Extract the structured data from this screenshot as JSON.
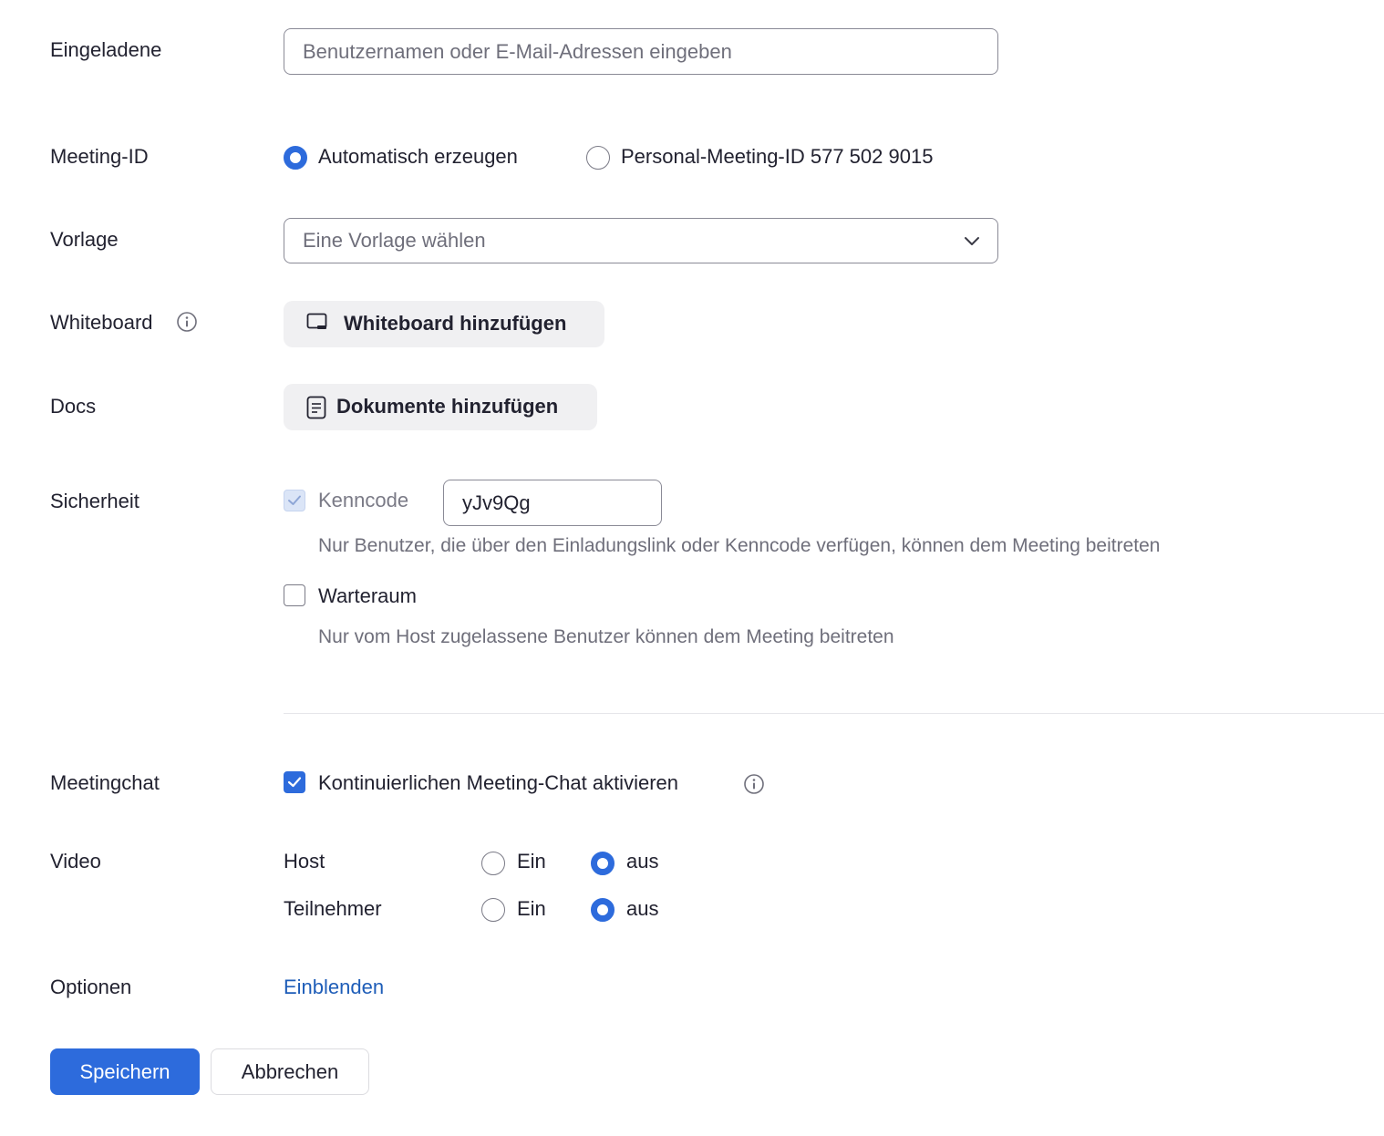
{
  "invitees": {
    "label": "Eingeladene",
    "placeholder": "Benutzernamen oder E-Mail-Adressen eingeben",
    "value": ""
  },
  "meeting_id": {
    "label": "Meeting-ID",
    "options": [
      {
        "label": "Automatisch erzeugen",
        "selected": true
      },
      {
        "label": "Personal-Meeting-ID 577 502 9015",
        "selected": false
      }
    ]
  },
  "template": {
    "label": "Vorlage",
    "selected_text": "Eine Vorlage wählen"
  },
  "whiteboard": {
    "label": "Whiteboard",
    "button_label": "Whiteboard hinzufügen",
    "icon": "whiteboard-icon"
  },
  "docs": {
    "label": "Docs",
    "button_label": "Dokumente hinzufügen",
    "icon": "document-icon"
  },
  "security": {
    "label": "Sicherheit",
    "passcode": {
      "label": "Kenncode",
      "checked": true,
      "disabled": true,
      "value": "yJv9Qg",
      "hint": "Nur Benutzer, die über den Einladungslink oder Kenncode verfügen, können dem Meeting beitreten"
    },
    "waiting_room": {
      "label": "Warteraum",
      "checked": false,
      "hint": "Nur vom Host zugelassene Benutzer können dem Meeting beitreten"
    }
  },
  "meeting_chat": {
    "label": "Meetingchat",
    "option_label": "Kontinuierlichen Meeting-Chat aktivieren",
    "checked": true
  },
  "video": {
    "label": "Video",
    "rows": [
      {
        "label": "Host",
        "on_label": "Ein",
        "off_label": "aus",
        "value": "aus"
      },
      {
        "label": "Teilnehmer",
        "on_label": "Ein",
        "off_label": "aus",
        "value": "aus"
      }
    ]
  },
  "options": {
    "label": "Optionen",
    "link_label": "Einblenden"
  },
  "actions": {
    "save_label": "Speichern",
    "cancel_label": "Abbrechen"
  },
  "colors": {
    "accent": "#2d6bdc",
    "link": "#1e5db8",
    "text": "#222230",
    "muted": "#6f6f7b"
  }
}
